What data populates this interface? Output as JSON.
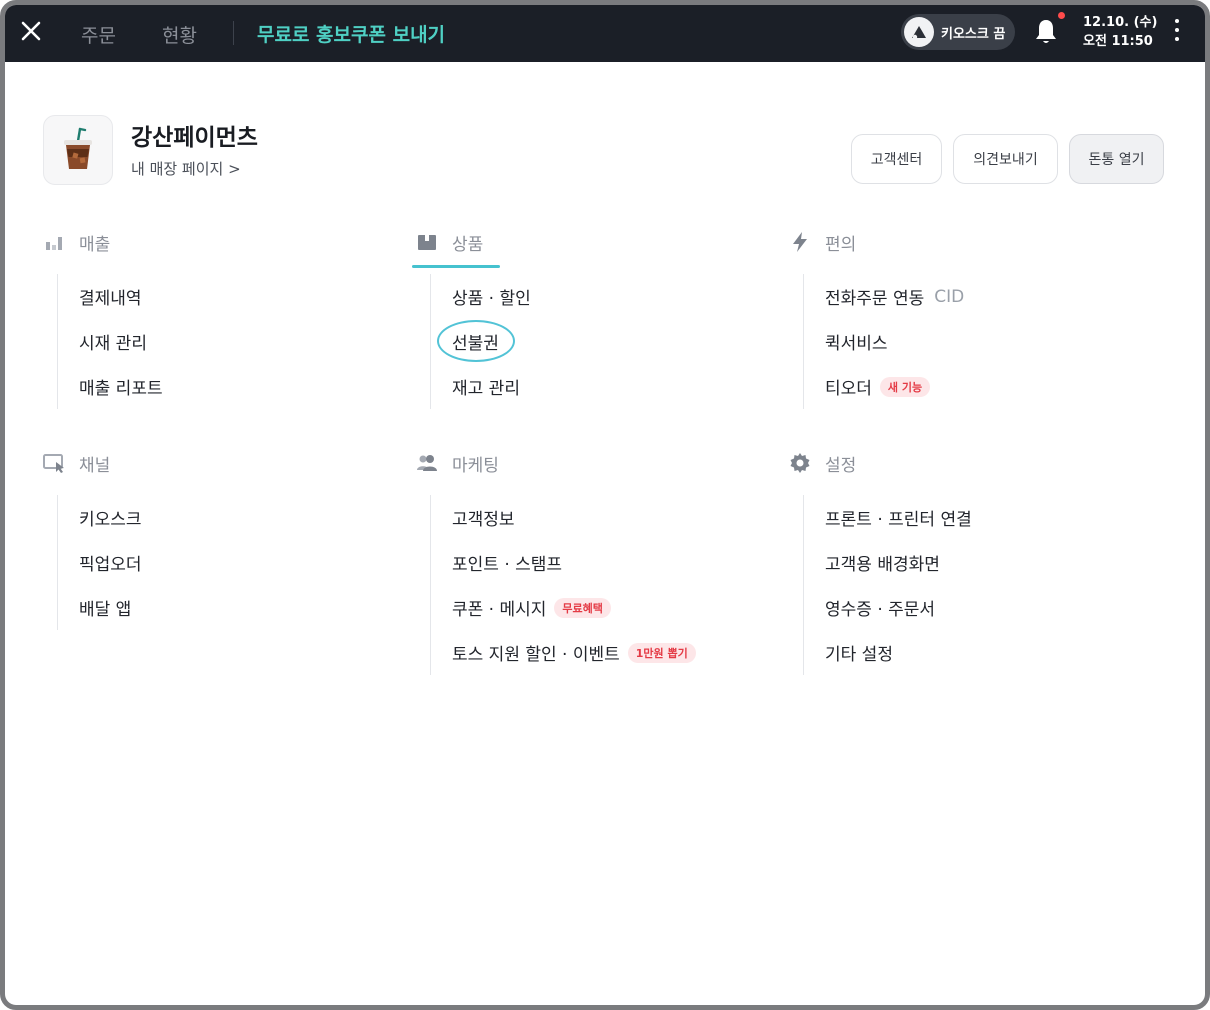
{
  "topbar": {
    "tabs": [
      "주문",
      "현황"
    ],
    "promo": "무료로 홍보쿠폰 보내기",
    "kiosk_label": "키오스크 끔",
    "date": "12.10. (수)",
    "time": "오전 11:50"
  },
  "store": {
    "name": "강산페이먼츠",
    "link": "내 매장 페이지 >"
  },
  "header_buttons": {
    "support": "고객센터",
    "feedback": "의견보내기",
    "cashbox": "돈통 열기"
  },
  "sections": {
    "sales": {
      "title": "매출",
      "items": [
        "결제내역",
        "시재 관리",
        "매출 리포트"
      ]
    },
    "products": {
      "title": "상품",
      "items": [
        "상품 · 할인",
        "선불권",
        "재고 관리"
      ]
    },
    "convenience": {
      "title": "편의",
      "items": [
        "전화주문 연동",
        "퀵서비스",
        "티오더"
      ],
      "cid": "CID",
      "new_badge": "새 기능"
    },
    "channel": {
      "title": "채널",
      "items": [
        "키오스크",
        "픽업오더",
        "배달 앱"
      ]
    },
    "marketing": {
      "title": "마케팅",
      "items": [
        "고객정보",
        "포인트 · 스탬프",
        "쿠폰 · 메시지",
        "토스 지원 할인 · 이벤트"
      ],
      "free_badge": "무료혜택",
      "promo_badge": "1만원 뽑기"
    },
    "settings": {
      "title": "설정",
      "items": [
        "프론트 · 프린터 연결",
        "고객용 배경화면",
        "영수증 · 주문서",
        "기타 설정"
      ]
    }
  },
  "colors": {
    "topbar_bg": "#1b1f27",
    "accent": "#46c2cf",
    "promo_text": "#4fd0c4",
    "badge_red": "#e43a45"
  }
}
